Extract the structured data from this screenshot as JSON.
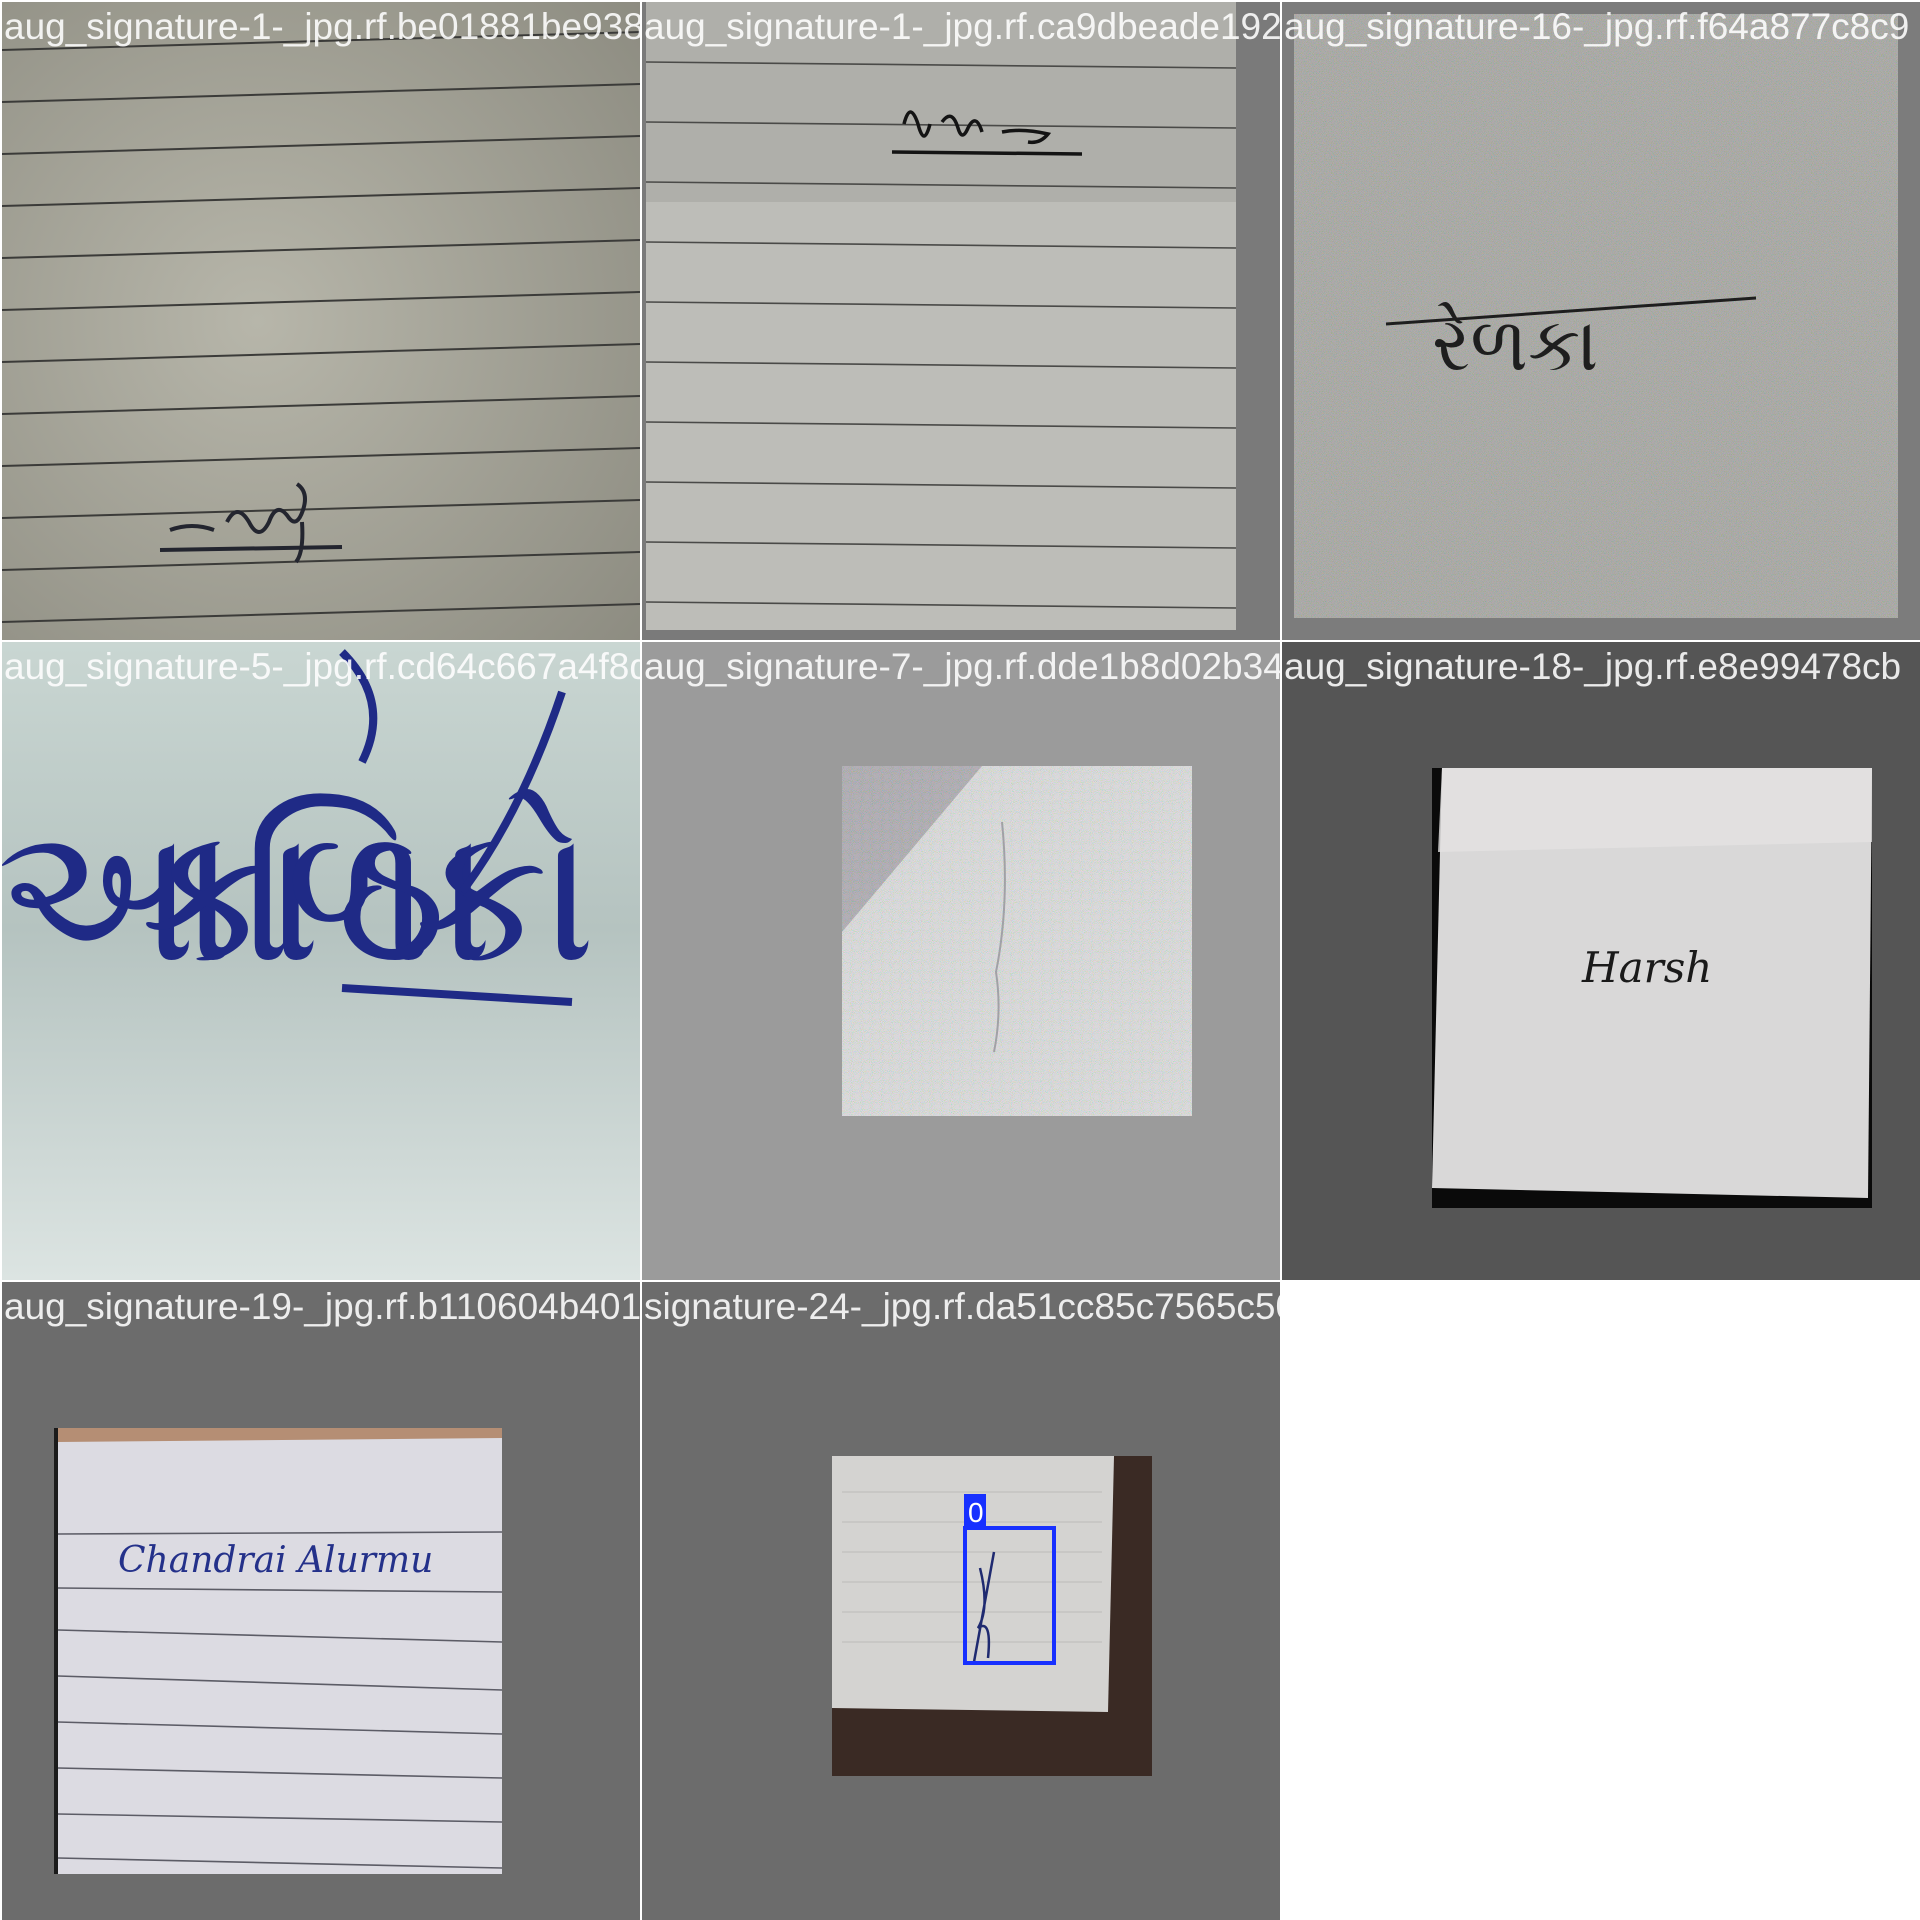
{
  "tiles": [
    {
      "filename": "aug_signature-1-_jpg.rf.be01881be938c055",
      "signature": "Jrcy"
    },
    {
      "filename": "aug_signature-1-_jpg.rf.ca9dbeade1928eb",
      "signature": "Amr"
    },
    {
      "filename": "aug_signature-16-_jpg.rf.f64a877c8c9",
      "signature": "રેળકા"
    },
    {
      "filename": "aug_signature-5-_jpg.rf.cd64c667a4f8d7b",
      "signature": "આ કાળિ ઠાકો"
    },
    {
      "filename": "aug_signature-7-_jpg.rf.dde1b8d02b34c269",
      "signature": ""
    },
    {
      "filename": "aug_signature-18-_jpg.rf.e8e99478cb",
      "signature": "Harsh"
    },
    {
      "filename": "aug_signature-19-_jpg.rf.b110604b401c577",
      "signature": "Chandrai Alurmu"
    },
    {
      "filename": "signature-24-_jpg.rf.da51cc85c7565c50370",
      "signature": "",
      "detection_label": "0"
    }
  ],
  "colors": {
    "separator": "#ffffff",
    "detection_box": "#1730ff",
    "ink_blue": "#1c2a8a",
    "ink_black": "#1a1a1a"
  }
}
